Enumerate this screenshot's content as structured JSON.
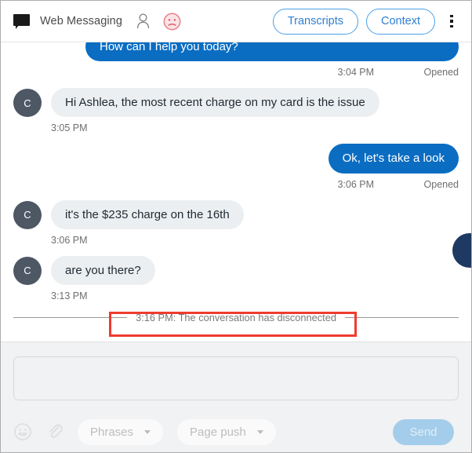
{
  "header": {
    "app_title": "Web Messaging",
    "chat_icon": "chat-bubble-icon",
    "person_icon": "person-icon",
    "sentiment_icon": "sad-face-icon",
    "transcripts_label": "Transcripts",
    "context_label": "Context",
    "more_icon": "kebab-menu-icon",
    "accent_color": "#2f7fd4"
  },
  "conversation": {
    "messages": [
      {
        "direction": "out",
        "text": "How can I help you today?",
        "time": "3:04 PM",
        "status": "Opened",
        "avatar": ""
      },
      {
        "direction": "in",
        "text": "Hi Ashlea, the most recent charge on my card is the issue",
        "time": "3:05 PM",
        "status": "",
        "avatar": "C"
      },
      {
        "direction": "out",
        "text": "Ok, let's take a look",
        "time": "3:06 PM",
        "status": "Opened",
        "avatar": ""
      },
      {
        "direction": "in",
        "text": "it's the $235 charge on the 16th",
        "time": "3:06 PM",
        "status": "",
        "avatar": "C"
      },
      {
        "direction": "in",
        "text": "are you there?",
        "time": "3:13 PM",
        "status": "",
        "avatar": "C"
      }
    ],
    "system_event": "3:16 PM: The conversation has disconnected",
    "highlight_color": "#f03b30",
    "outgoing_bubble_color": "#0a6dc2",
    "incoming_bubble_color": "#eceff1",
    "avatar_color": "#4e5764"
  },
  "composer": {
    "input_value": "",
    "input_placeholder": "",
    "emoji_icon": "emoji-smiley-icon",
    "attach_icon": "paperclip-icon",
    "phrases_label": "Phrases",
    "page_push_label": "Page push",
    "send_label": "Send"
  }
}
